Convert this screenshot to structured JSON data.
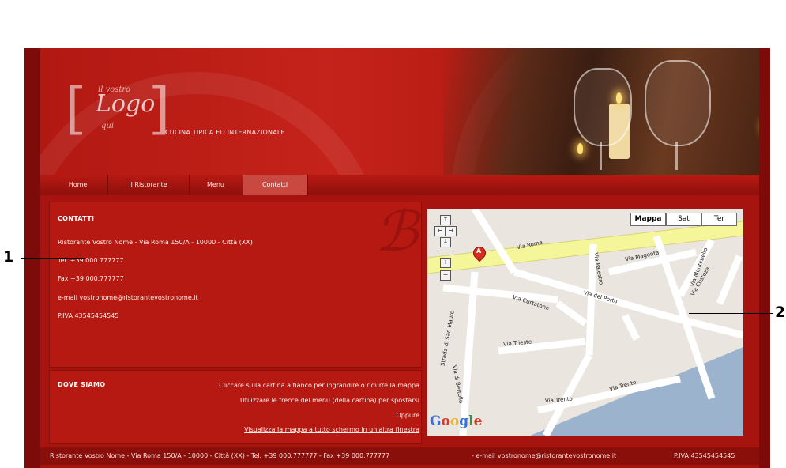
{
  "header": {
    "logo": {
      "top": "il vostro",
      "main": "Logo",
      "bottom": "qui"
    },
    "tagline": "CUCINA TIPICA ED INTERNAZIONALE"
  },
  "nav": {
    "items": [
      {
        "label": "Home"
      },
      {
        "label": "Il Ristorante"
      },
      {
        "label": "Menu"
      },
      {
        "label": "Contatti",
        "active": true
      }
    ]
  },
  "contatti": {
    "title": "CONTATTI",
    "lines": [
      "Ristorante Vostro Nome  - Via Roma 150/A - 10000 - Città (XX)",
      "Tel. +39 000.777777",
      "Fax +39 000.777777",
      "e-mail vostronome@ristorantevostronome.it",
      "P.IVA 43545454545"
    ]
  },
  "dove_siamo": {
    "title": "DOVE SIAMO",
    "lines": [
      "Cliccare sulla cartina a fianco per ingrandire o ridurre la mappa",
      "Utilizzare le frecce del menu (della cartina) per spostarsi",
      "Oppure",
      "Visualizza la mappa a tutto schermo in un'altra finestra"
    ]
  },
  "map": {
    "type_buttons": [
      "Mappa",
      "Sat",
      "Ter"
    ],
    "selected": "Mappa",
    "marker_label": "A",
    "streets": [
      "Via Roma",
      "Via Magenta",
      "Via Palestro",
      "Via Curtatone",
      "Via del Porto",
      "Via Trieste",
      "Strada di San Mauro",
      "Via Trento",
      "Via Montebello",
      "Via Custoza",
      "Via Trento",
      "Via di Bertolla"
    ],
    "attribution": "Google"
  },
  "footer": {
    "left": "Ristorante Vostro Nome - Via Roma 150/A - 10000 - Città (XX) - Tel. +39 000.777777 - Fax +39 000.777777",
    "email": "- e-mail vostronome@ristorantevostronome.it",
    "piva": "P.IVA 43545454545"
  },
  "callouts": {
    "one": "1",
    "two": "2"
  },
  "colors": {
    "accent": "#a7140f",
    "dark": "#7c0b09",
    "map_road_main": "#f5f59a",
    "water": "#9bb3cc"
  }
}
